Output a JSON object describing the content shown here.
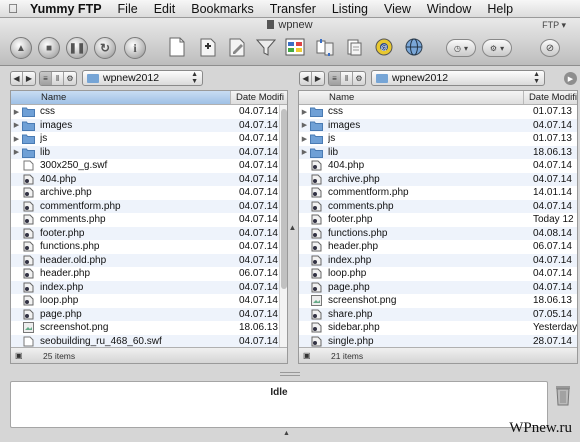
{
  "menubar": {
    "app": "Yummy FTP",
    "items": [
      "File",
      "Edit",
      "Bookmarks",
      "Transfer",
      "Listing",
      "View",
      "Window",
      "Help"
    ]
  },
  "window": {
    "title": "wpnew",
    "badge": "FTP"
  },
  "left_pane": {
    "path": "wpnew2012",
    "col_name": "Name",
    "col_date": "Date Modifi",
    "count": "25 items",
    "rows": [
      {
        "name": "css",
        "date": "04.07.14",
        "type": "folder"
      },
      {
        "name": "images",
        "date": "04.07.14",
        "type": "folder"
      },
      {
        "name": "js",
        "date": "04.07.14",
        "type": "folder"
      },
      {
        "name": "lib",
        "date": "04.07.14",
        "type": "folder"
      },
      {
        "name": "300x250_g.swf",
        "date": "04.07.14",
        "type": "file"
      },
      {
        "name": "404.php",
        "date": "04.07.14",
        "type": "php"
      },
      {
        "name": "archive.php",
        "date": "04.07.14",
        "type": "php"
      },
      {
        "name": "commentform.php",
        "date": "04.07.14",
        "type": "php"
      },
      {
        "name": "comments.php",
        "date": "04.07.14",
        "type": "php"
      },
      {
        "name": "footer.php",
        "date": "04.07.14",
        "type": "php"
      },
      {
        "name": "functions.php",
        "date": "04.07.14",
        "type": "php"
      },
      {
        "name": "header.old.php",
        "date": "04.07.14",
        "type": "php"
      },
      {
        "name": "header.php",
        "date": "06.07.14",
        "type": "php"
      },
      {
        "name": "index.php",
        "date": "04.07.14",
        "type": "php"
      },
      {
        "name": "loop.php",
        "date": "04.07.14",
        "type": "php"
      },
      {
        "name": "page.php",
        "date": "04.07.14",
        "type": "php"
      },
      {
        "name": "screenshot.png",
        "date": "18.06.13",
        "type": "image"
      },
      {
        "name": "seobuilding_ru_468_60.swf",
        "date": "04.07.14",
        "type": "file"
      }
    ]
  },
  "right_pane": {
    "path": "wpnew2012",
    "col_name": "Name",
    "col_date": "Date Modifi",
    "count": "21 items",
    "rows": [
      {
        "name": "css",
        "date": "01.07.13",
        "type": "folder"
      },
      {
        "name": "images",
        "date": "04.07.14",
        "type": "folder"
      },
      {
        "name": "js",
        "date": "01.07.13",
        "type": "folder"
      },
      {
        "name": "lib",
        "date": "18.06.13",
        "type": "folder"
      },
      {
        "name": "404.php",
        "date": "04.07.14",
        "type": "php"
      },
      {
        "name": "archive.php",
        "date": "04.07.14",
        "type": "php"
      },
      {
        "name": "commentform.php",
        "date": "14.01.14",
        "type": "php"
      },
      {
        "name": "comments.php",
        "date": "04.07.14",
        "type": "php"
      },
      {
        "name": "footer.php",
        "date": "Today 12",
        "type": "php"
      },
      {
        "name": "functions.php",
        "date": "04.08.14",
        "type": "php"
      },
      {
        "name": "header.php",
        "date": "06.07.14",
        "type": "php"
      },
      {
        "name": "index.php",
        "date": "04.07.14",
        "type": "php"
      },
      {
        "name": "loop.php",
        "date": "04.07.14",
        "type": "php"
      },
      {
        "name": "page.php",
        "date": "04.07.14",
        "type": "php"
      },
      {
        "name": "screenshot.png",
        "date": "18.06.13",
        "type": "image"
      },
      {
        "name": "share.php",
        "date": "07.05.14",
        "type": "php"
      },
      {
        "name": "sidebar.php",
        "date": "Yesterday",
        "type": "php"
      },
      {
        "name": "single.php",
        "date": "28.07.14",
        "type": "php"
      }
    ]
  },
  "log": {
    "status": "Idle"
  },
  "watermark": "WPnew.ru",
  "colors": {
    "folder": "#6fa0d6",
    "selection": "#a9c8ea",
    "stripe": "#eef3fb"
  }
}
